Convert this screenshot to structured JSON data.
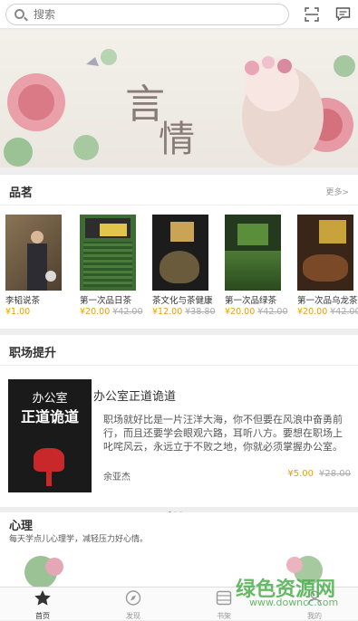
{
  "search": {
    "placeholder": "搜索"
  },
  "banner": {
    "title_1": "言",
    "title_2": "情"
  },
  "tea": {
    "title": "品茗",
    "more": "更多>",
    "books": [
      {
        "name": "李韬说茶",
        "price": "¥1.00",
        "old": ""
      },
      {
        "name": "第一次品日茶",
        "price": "¥20.00",
        "old": "¥42.00"
      },
      {
        "name": "茶文化与茶健康",
        "price": "¥12.00",
        "old": "¥38.80"
      },
      {
        "name": "第一次品绿茶",
        "price": "¥20.00",
        "old": "¥42.00"
      },
      {
        "name": "第一次品乌龙茶",
        "price": "¥20.00",
        "old": "¥42.00"
      }
    ]
  },
  "career": {
    "title": "职场提升",
    "book_title": "办公室正道诡道",
    "desc": "职场就好比是一片汪洋大海，你不但要在风浪中奋勇前行，而且还要学会眼观六路，耳听八方。要想在职场上叱咤风云，永远立于不败之地，你就必须掌握办公室。",
    "author": "余亚杰",
    "price": "¥5.00",
    "old": "¥28.00",
    "cover_line1": "办公室",
    "cover_line2": "正道诡道"
  },
  "psych": {
    "title": "心理",
    "subtitle": "每天学点儿心理学，减轻压力好心情。"
  },
  "tabs": [
    {
      "label": "首页"
    },
    {
      "label": "发现"
    },
    {
      "label": "书架"
    },
    {
      "label": "我的"
    }
  ],
  "watermark": {
    "text": "绿色资源网",
    "url": "www.downcc.com"
  }
}
